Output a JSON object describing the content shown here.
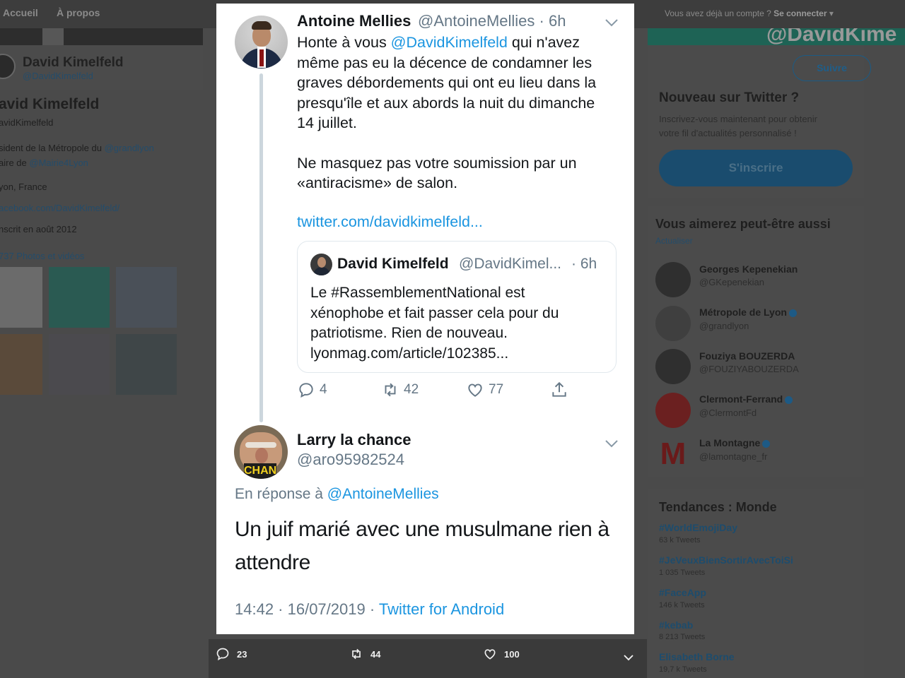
{
  "background": {
    "topnav": {
      "home": "Accueil",
      "about": "À propos",
      "login_prompt": "Vous avez déjà un compte ?",
      "login": "Se connecter"
    },
    "banner_text": "@DavidKime",
    "profile": {
      "name": "David Kimelfeld",
      "handle": "@DavidKimelfeld",
      "name_large": "avid Kimelfeld",
      "handle_cut": "avidKimelfeld",
      "bio_line1": "sident de la Métropole du ",
      "bio_line1_link": "@grandlyon",
      "bio_line2": "aire de ",
      "bio_line2_link": "@Mairie4Lyon",
      "location": "yon, France",
      "website": "acebook.com/DavidKimelfeld/",
      "joined": "nscrit en août 2012",
      "photos": "737 Photos et vidéos"
    },
    "right": {
      "follow_button": "Suivre",
      "new_title": "Nouveau sur Twitter ?",
      "new_text1": "Inscrivez-vous maintenant pour obtenir",
      "new_text2": "votre fil d'actualités personnalisé !",
      "signup_button": "S'inscrire",
      "suggest_title": "Vous aimerez peut-être aussi",
      "refresh": "Actualiser",
      "suggestions": [
        {
          "name": "Georges Kepenekian",
          "handle": "@GKepenekian",
          "verified": false
        },
        {
          "name": "Métropole de Lyon",
          "handle": "@grandlyon",
          "verified": true
        },
        {
          "name": "Fouziya BOUZERDA",
          "handle": "@FOUZIYABOUZERDA",
          "verified": false
        },
        {
          "name": "Clermont-Ferrand",
          "handle": "@ClermontFd",
          "verified": true
        },
        {
          "name": "La Montagne",
          "handle": "@lamontagne_fr",
          "verified": true
        }
      ],
      "trends_title": "Tendances : Monde",
      "trends": [
        {
          "tag": "#WorldEmojiDay",
          "count": "63 k Tweets"
        },
        {
          "tag": "#JeVeuxBienSortirAvecToiSi",
          "count": "1 035 Tweets"
        },
        {
          "tag": "#FaceApp",
          "count": "146 k Tweets"
        },
        {
          "tag": "#kebab",
          "count": "8 213 Tweets"
        },
        {
          "tag": "Elisabeth Borne",
          "count": "19,7 k Tweets"
        }
      ]
    }
  },
  "bottom_bar": {
    "replies": "23",
    "retweets": "44",
    "likes": "100"
  },
  "tweet": {
    "author_name": "Antoine Mellies",
    "author_handle": "@AntoineMellies · 6h",
    "text_pre": "Honte à vous ",
    "mention": "@DavidKimelfeld",
    "text_post": " qui n'avez\nmême pas eu la décence de condamner les\ngraves débordements qui ont eu lieu dans la\npresqu'île et aux abords la nuit du dimanche\n14 juillet.",
    "text_p2": "Ne masquez pas votre soumission par un\n«antiracisme» de salon.",
    "url": "twitter.com/davidkimelfeld...",
    "quote": {
      "name": "David Kimelfeld",
      "handle": "@DavidKimel...",
      "time": "· 6h",
      "text": "Le #RassemblementNational est\nxénophobe et fait passer cela pour du\npatriotisme. Rien de nouveau.\nlyonmag.com/article/102385..."
    },
    "replies": "4",
    "retweets": "42",
    "likes": "77"
  },
  "reply": {
    "author_name": "Larry la chance",
    "author_handle": "@aro95982524",
    "avatar_sign": "CHAN",
    "in_reply_label": "En réponse à ",
    "in_reply_to": "@AntoineMellies",
    "text": "Un juif marié avec une musulmane rien à attendre",
    "time": "14:42 · 16/07/2019 · ",
    "source": "Twitter for Android"
  },
  "colors": {
    "link": "#1b95e0",
    "secondary_text": "#657786",
    "background": "#4a4a4a"
  }
}
